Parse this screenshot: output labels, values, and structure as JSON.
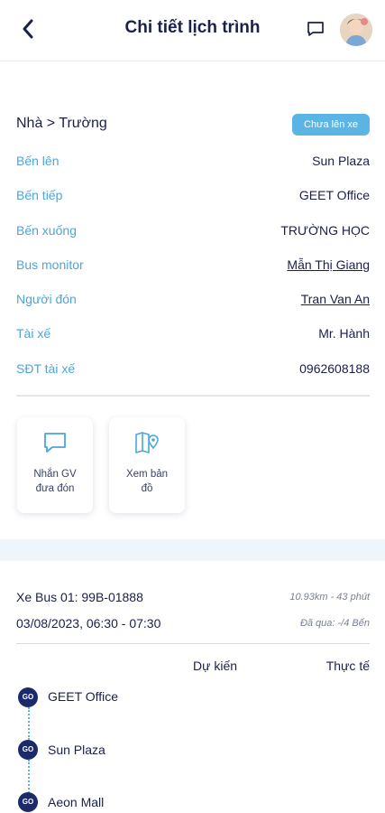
{
  "header": {
    "title": "Chi tiết lịch trình"
  },
  "route": {
    "title": "Nhà > Trường",
    "status": "Chưa lên xe",
    "status_color": "#5bb4e3"
  },
  "info": [
    {
      "label": "Bến lên",
      "value": "Sun Plaza",
      "link": false
    },
    {
      "label": "Bến tiếp",
      "value": "GEET Office",
      "link": false
    },
    {
      "label": "Bến xuống",
      "value": "TRƯỜNG HỌC",
      "link": false
    },
    {
      "label": "Bus monitor",
      "value": "Mẫn Thị Giang",
      "link": true
    },
    {
      "label": "Người đón",
      "value": "Tran Van An",
      "link": true
    },
    {
      "label": "Tài xế",
      "value": "Mr. Hành",
      "link": false
    },
    {
      "label": "SĐT tài xế",
      "value": "0962608188",
      "link": false
    }
  ],
  "actions": [
    {
      "line1": "Nhắn GV",
      "line2": "đưa đón",
      "icon": "chat-icon"
    },
    {
      "line1": "Xem bản",
      "line2": "đồ",
      "icon": "map-icon"
    }
  ],
  "bus": {
    "name": "Xe Bus 01: 99B-01888",
    "time": "03/08/2023, 06:30 - 07:30",
    "distance": "10.93km - 43 phút",
    "passed": "Đã qua: -/4 Bến"
  },
  "columns": {
    "expected": "Dự kiến",
    "actual": "Thực tế"
  },
  "stops": [
    {
      "badge": "GO",
      "name": "GEET Office"
    },
    {
      "badge": "GO",
      "name": "Sun Plaza"
    },
    {
      "badge": "GO",
      "name": "Aeon Mall"
    }
  ],
  "colors": {
    "primary": "#1b1f4b",
    "accent": "#4aa6dc",
    "badge": "#5bb4e3"
  }
}
